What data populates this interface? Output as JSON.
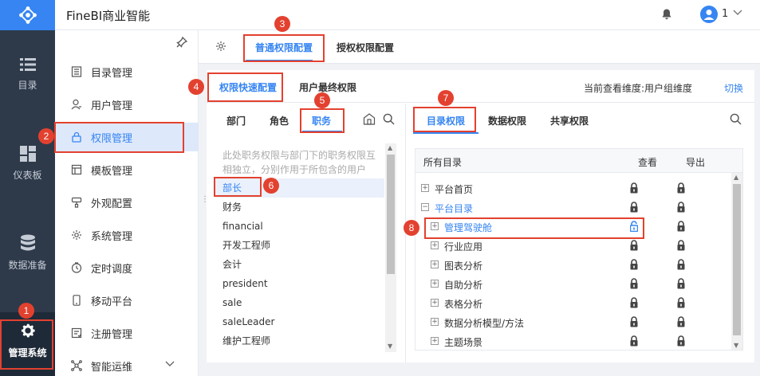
{
  "app": {
    "title": "FineBI商业智能"
  },
  "user": {
    "name": "1"
  },
  "rail": {
    "items": [
      {
        "label": "目录",
        "icon": "list-icon"
      },
      {
        "label": "仪表板",
        "icon": "dashboard-icon"
      },
      {
        "label": "数据准备",
        "icon": "database-icon"
      },
      {
        "label": "管理系统",
        "icon": "gear-icon"
      }
    ]
  },
  "sidebar": {
    "items": [
      {
        "label": "目录管理",
        "icon": "directory-icon"
      },
      {
        "label": "用户管理",
        "icon": "user-icon"
      },
      {
        "label": "权限管理",
        "icon": "lock-icon"
      },
      {
        "label": "模板管理",
        "icon": "template-icon"
      },
      {
        "label": "外观配置",
        "icon": "brush-icon"
      },
      {
        "label": "系统管理",
        "icon": "settings-icon"
      },
      {
        "label": "定时调度",
        "icon": "clock-icon"
      },
      {
        "label": "移动平台",
        "icon": "mobile-icon"
      },
      {
        "label": "注册管理",
        "icon": "register-icon"
      },
      {
        "label": "智能运维",
        "icon": "ops-icon"
      }
    ]
  },
  "tabs": {
    "level1": [
      {
        "label": "普通权限配置"
      },
      {
        "label": "授权权限配置"
      }
    ],
    "level2": [
      {
        "label": "权限快速配置"
      },
      {
        "label": "用户最终权限"
      }
    ],
    "dimension_label": "当前查看维度:用户组维度",
    "switch_label": "切换",
    "level3": [
      {
        "label": "部门"
      },
      {
        "label": "角色"
      },
      {
        "label": "职务"
      }
    ],
    "level4": [
      {
        "label": "目录权限"
      },
      {
        "label": "数据权限"
      },
      {
        "label": "共享权限"
      }
    ]
  },
  "positions": {
    "description": "此处职务权限与部门下的职务权限互相独立，分别作用于所包含的用户",
    "items": [
      "部长",
      "财务",
      "financial",
      "开发工程师",
      "会计",
      "president",
      "sale",
      "saleLeader",
      "维护工程师"
    ]
  },
  "directory": {
    "columns": [
      "所有目录",
      "查看",
      "导出"
    ],
    "rows": [
      {
        "label": "平台首页",
        "toggle": "+"
      },
      {
        "label": "平台目录",
        "toggle": "−"
      },
      {
        "label": "管理驾驶舱",
        "toggle": "+"
      },
      {
        "label": "行业应用",
        "toggle": "+"
      },
      {
        "label": "图表分析",
        "toggle": "+"
      },
      {
        "label": "自助分析",
        "toggle": "+"
      },
      {
        "label": "表格分析",
        "toggle": "+"
      },
      {
        "label": "数据分析模型/方法",
        "toggle": "+"
      },
      {
        "label": "主题场景",
        "toggle": "+"
      }
    ]
  },
  "annotations": [
    "1",
    "2",
    "3",
    "4",
    "5",
    "6",
    "7",
    "8"
  ],
  "colors": {
    "accent": "#3685f2",
    "annotation": "#e3412f",
    "rail": "#2e3a4a"
  }
}
